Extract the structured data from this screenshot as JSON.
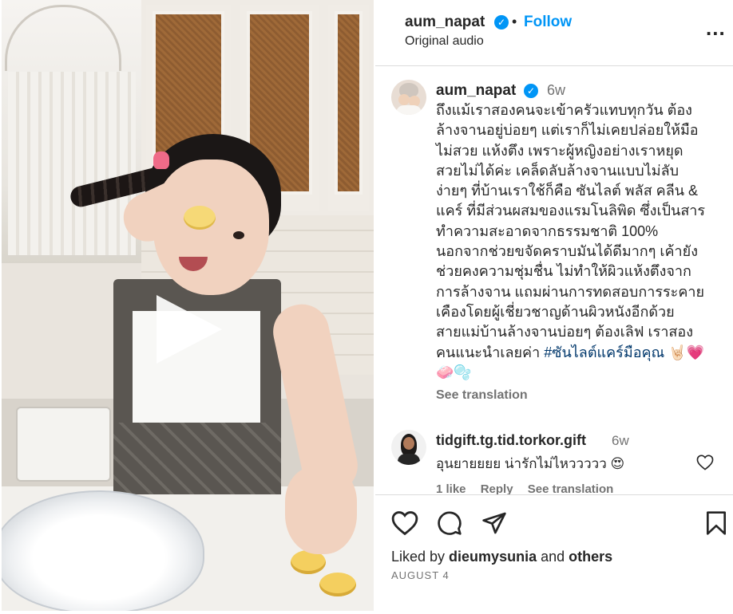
{
  "header": {
    "username": "aum_napat",
    "follow_label": "Follow",
    "dot": "•",
    "audio": "Original audio",
    "more_label": "..."
  },
  "caption": {
    "username": "aum_napat",
    "time": "6w",
    "lines": [
      "ถึงแม้เราสองคนจะเข้าครัวแทบทุกวัน ต้อง",
      "ล้างจานอยู่บ่อยๆ แต่เราก็ไม่เคยปล่อยให้มือ",
      "ไม่สวย แห้งตึง เพราะผู้หญิงอย่างเราหยุด",
      "สวยไม่ได้ค่ะ เคล็ดลับล้างจานแบบไม่ลับ",
      "ง่ายๆ ที่บ้านเราใช้ก็คือ ซันไลต์ พลัส คลีน &",
      "แคร์ ที่มีส่วนผสมของแรมโนลิพิด ซึ่งเป็นสาร",
      "ทำความสะอาดจากธรรมชาติ 100%",
      "นอกจากช่วยขจัดคราบมันได้ดีมากๆ เค้ายัง",
      "ช่วยคงความชุ่มชื่น ไม่ทำให้ผิวแห้งตึงจาก",
      "การล้างจาน แถมผ่านการทดสอบการระคาย",
      "เคืองโดยผู้เชี่ยวชาญด้านผิวหนังอีกด้วย",
      "สายแม่บ้านล้างจานบ่อยๆ ต้องเลิฟ เราสอง"
    ],
    "last_line_text": "คนแนะนำเลยค่า ",
    "hashtag": "#ซันไลต์แคร์มือคุณ",
    "emoji_line_1": " 🤘🏻💗",
    "emoji_line_2": "🧼🫧",
    "see_translation": "See translation"
  },
  "comment": {
    "username": "tidgift.tg.tid.torkor.gift",
    "time": "6w",
    "text": "อุนยายยยย น่ารักไม่ไหววววว 😍",
    "likes": "1 like",
    "reply": "Reply",
    "see_translation": "See translation"
  },
  "footer": {
    "liked_prefix": "Liked by ",
    "liked_user": "dieumysunia",
    "liked_and": " and ",
    "liked_others": "others",
    "date": "AUGUST 4"
  },
  "icons": [
    "verified-badge-icon",
    "more-options-icon",
    "heart-icon",
    "comment-icon",
    "share-icon",
    "bookmark-icon",
    "play-icon"
  ],
  "colors": {
    "link_blue": "#0095f6",
    "hashtag": "#00376b",
    "muted": "#737373",
    "text": "#262626"
  }
}
